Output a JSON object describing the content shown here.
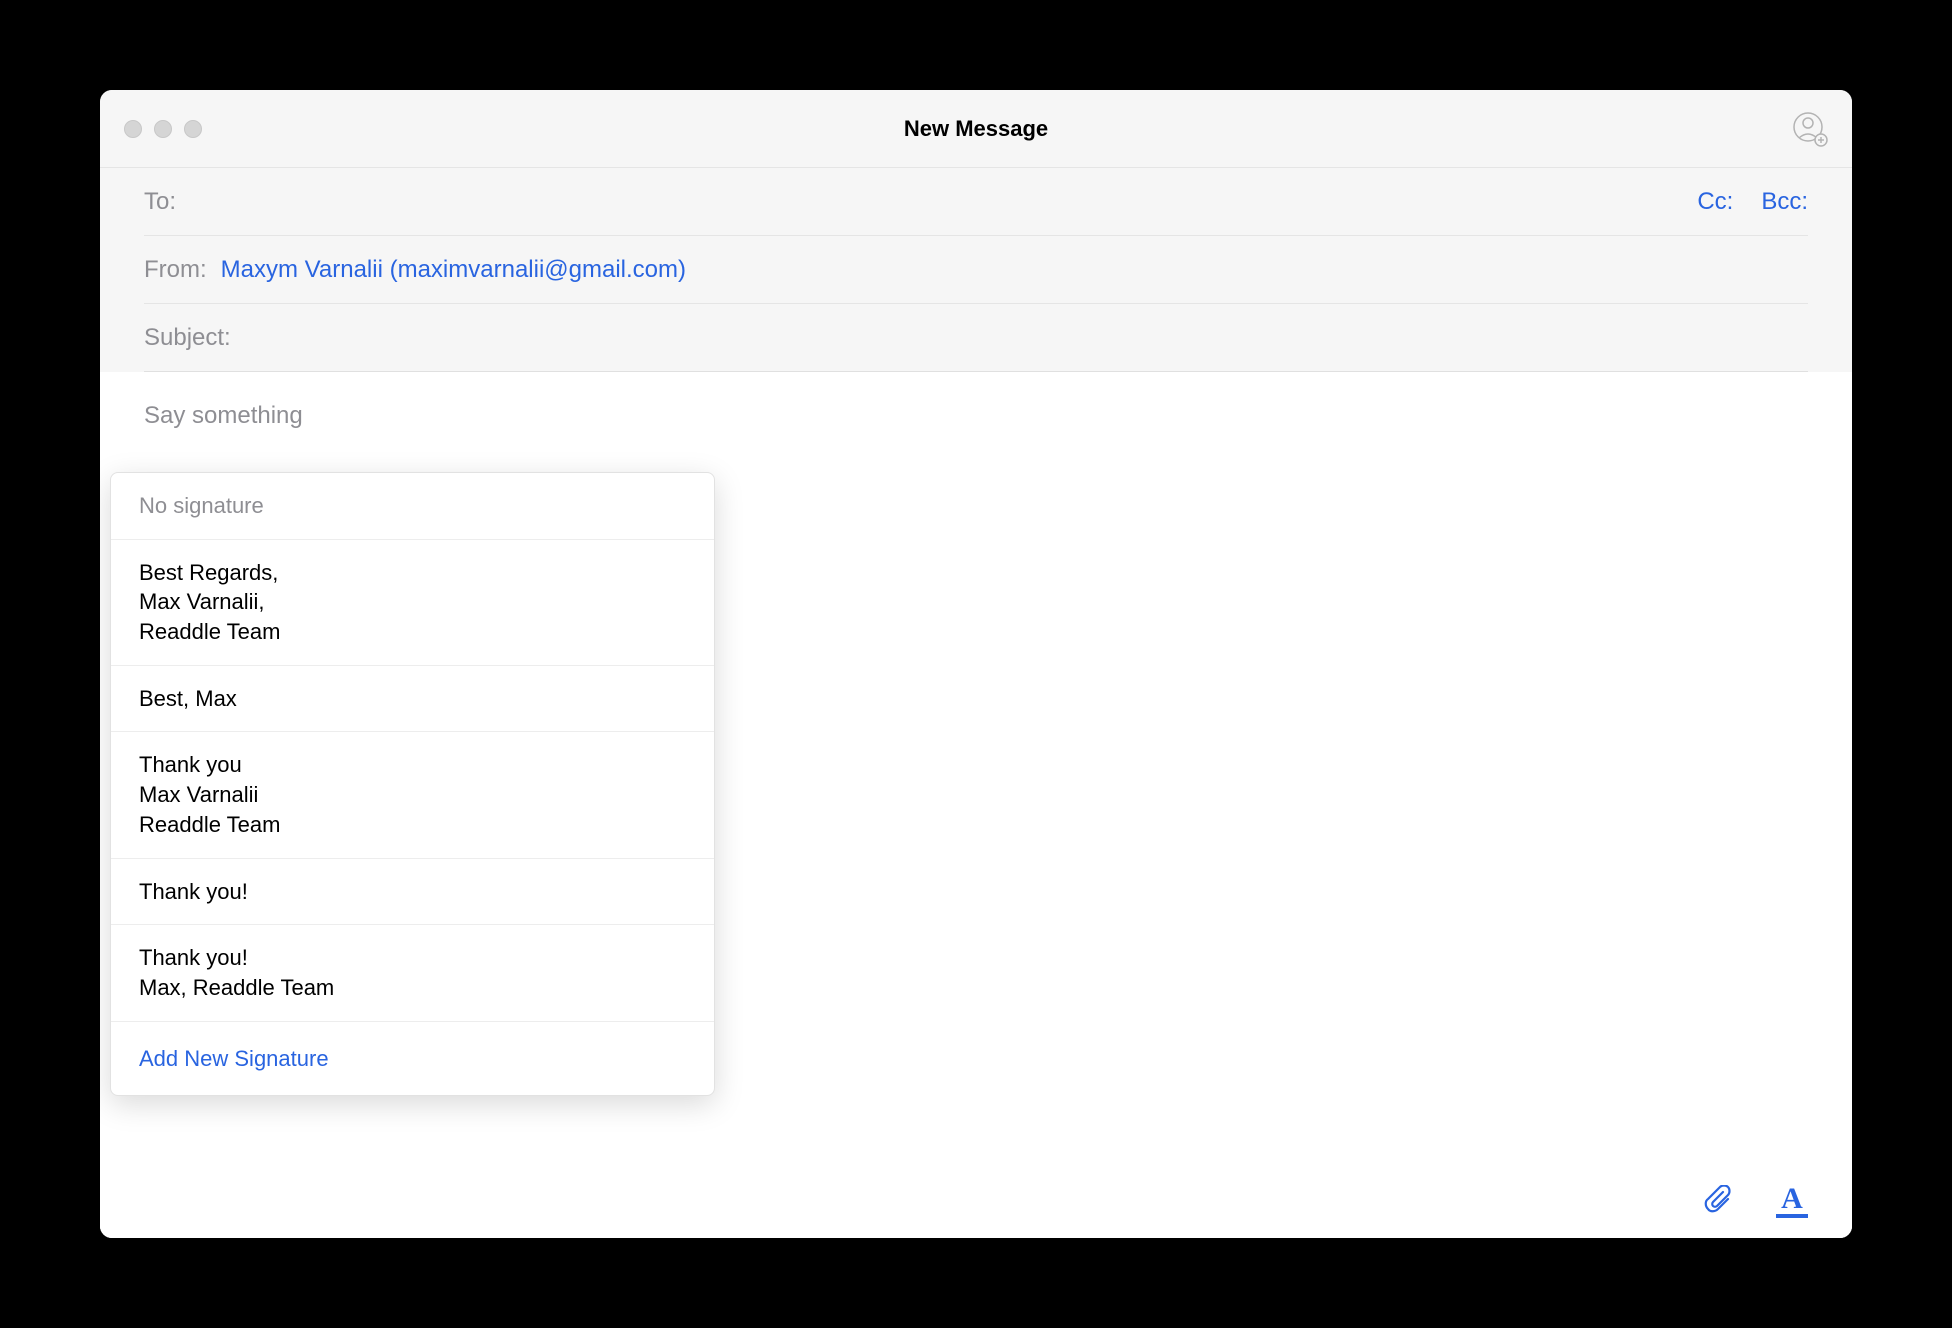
{
  "window": {
    "title": "New Message"
  },
  "fields": {
    "to_label": "To:",
    "cc_label": "Cc:",
    "bcc_label": "Bcc:",
    "from_label": "From:",
    "from_value": "Maxym Varnalii (maximvarnalii@gmail.com)",
    "subject_label": "Subject:"
  },
  "body": {
    "placeholder": "Say something"
  },
  "signatures": {
    "no_signature_label": "No signature",
    "items": [
      "Best Regards,\nMax Varnalii,\nReaddle Team",
      "Best, Max",
      "Thank you\nMax Varnalii\nReaddle Team",
      "Thank you!",
      "Thank you!\nMax, Readdle Team"
    ],
    "add_new_label": "Add New Signature"
  },
  "toolbar": {
    "format_letter": "A"
  }
}
